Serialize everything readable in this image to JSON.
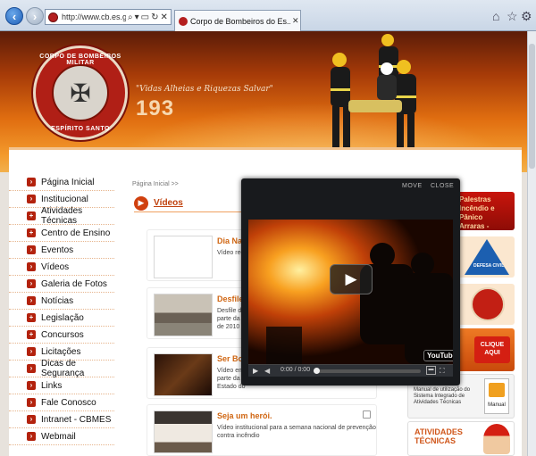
{
  "browser": {
    "url": "http://www.cb.es.gov.br/cc",
    "tab_title": "Corpo de Bombeiros do Es...",
    "colors": {
      "back_button": "#1f5fb8",
      "chrome": "#dfe7f1"
    }
  },
  "header": {
    "emblem_top_text": "CORPO DE BOMBEIROS MILITAR",
    "emblem_bottom_text": "ESPÍRITO SANTO",
    "slogan": "\"Vidas Alheias e Riquezas Salvar\"",
    "emergency_number": "193",
    "colors": {
      "dark": "#5b1c08",
      "mid": "#e06d10",
      "light": "#f2b04c"
    }
  },
  "sidebar": {
    "items": [
      {
        "label": "Página Inicial",
        "bullet": "›"
      },
      {
        "label": "Institucional",
        "bullet": "›"
      },
      {
        "label": "Atividades Técnicas",
        "bullet": "+"
      },
      {
        "label": "Centro de Ensino",
        "bullet": "+"
      },
      {
        "label": "Eventos",
        "bullet": "›"
      },
      {
        "label": "Vídeos",
        "bullet": "›"
      },
      {
        "label": "Galeria de Fotos",
        "bullet": "›"
      },
      {
        "label": "Notícias",
        "bullet": "›"
      },
      {
        "label": "Legislação",
        "bullet": "+"
      },
      {
        "label": "Concursos",
        "bullet": "+"
      },
      {
        "label": "Licitações",
        "bullet": "›"
      },
      {
        "label": "Dicas de Segurança",
        "bullet": "›"
      },
      {
        "label": "Links",
        "bullet": "›"
      },
      {
        "label": "Fale Conosco",
        "bullet": "›"
      },
      {
        "label": "Intranet - CBMES",
        "bullet": "›"
      },
      {
        "label": "Webmail",
        "bullet": "›"
      }
    ]
  },
  "main": {
    "breadcrumb": "Página Inicial >>",
    "section_title": "Vídeos",
    "videos": [
      {
        "title": "Dia Naci",
        "desc": "Vídeo rede"
      },
      {
        "title": "Desfile d",
        "desc": "Desfile do\nparte da\nde 2010"
      },
      {
        "title": "Ser Bom",
        "desc": "Vídeo em\nparte da\nEstado do"
      },
      {
        "title": "Seja um herói.",
        "desc": "Vídeo institucional para a semana nacional de prevenção contra incêndio"
      }
    ]
  },
  "banners": {
    "palestras": "Palestras\nIncêndio e Pânico\nArraras - Espírito Santo",
    "defesa_civil": "DEFESA CIVIL",
    "clique": "CLIQUE\nAQUI",
    "manual_text": "Manual de utilização do Sistema Integrado de Atividades Técnicas",
    "manual_label": "Manual",
    "atividades": "ATIVIDADES\nTÉCNICAS"
  },
  "player": {
    "move_label": "MOVE",
    "close_label": "CLOSE",
    "time": "0:00 / 0:00",
    "progress": 0,
    "youtube_label": "YouTube"
  }
}
